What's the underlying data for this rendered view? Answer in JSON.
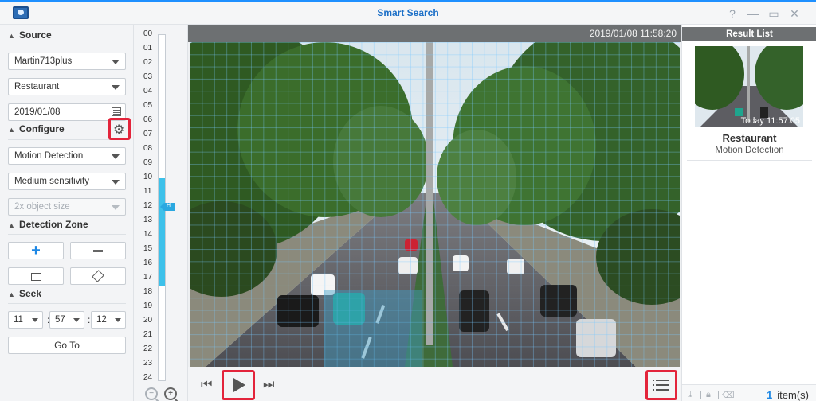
{
  "window": {
    "title": "Smart Search",
    "buttons": {
      "help": "?",
      "minimize": "—",
      "maximize": "▭",
      "close": "✕"
    }
  },
  "left": {
    "source": {
      "header": "Source",
      "camera": "Martin713plus",
      "location": "Restaurant",
      "date": "2019/01/08"
    },
    "configure": {
      "header": "Configure",
      "mode": "Motion Detection",
      "sensitivity": "Medium sensitivity",
      "object_size": "2x object size"
    },
    "detection_zone": {
      "header": "Detection Zone"
    },
    "seek": {
      "header": "Seek",
      "hour": "11",
      "minute": "57",
      "second": "12",
      "go_label": "Go To"
    }
  },
  "timeline": {
    "hours": [
      "00",
      "01",
      "02",
      "03",
      "04",
      "05",
      "06",
      "07",
      "08",
      "09",
      "10",
      "11",
      "12",
      "13",
      "14",
      "15",
      "16",
      "17",
      "18",
      "19",
      "20",
      "21",
      "22",
      "23",
      "24"
    ],
    "highlight_start_hour": 10,
    "highlight_end_hour": 17,
    "current_hour": 11.95,
    "handle_label": "H"
  },
  "video": {
    "timestamp": "2019/01/08 11:58:20"
  },
  "result_list": {
    "header": "Result List",
    "items": [
      {
        "time": "Today 11:57:05",
        "name": "Restaurant",
        "type": "Motion Detection"
      }
    ],
    "count": "1",
    "count_label": "item(s)"
  },
  "colors": {
    "accent": "#1e90ff",
    "highlight": "#e3243b",
    "timeline_fill": "#3dc1ea",
    "header_gray": "#6d7072"
  }
}
